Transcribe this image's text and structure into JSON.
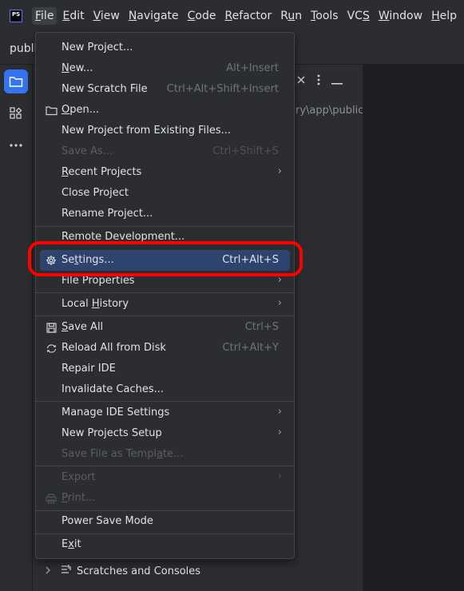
{
  "menubar": {
    "logo_text": "PS",
    "items": [
      {
        "pre": "",
        "ul": "F",
        "post": "ile"
      },
      {
        "pre": "",
        "ul": "E",
        "post": "dit"
      },
      {
        "pre": "",
        "ul": "V",
        "post": "iew"
      },
      {
        "pre": "",
        "ul": "N",
        "post": "avigate"
      },
      {
        "pre": "",
        "ul": "C",
        "post": "ode"
      },
      {
        "pre": "",
        "ul": "R",
        "post": "efactor"
      },
      {
        "pre": "R",
        "ul": "u",
        "post": "n"
      },
      {
        "pre": "",
        "ul": "T",
        "post": "ools"
      },
      {
        "pre": "VC",
        "ul": "S",
        "post": ""
      },
      {
        "pre": "",
        "ul": "W",
        "post": "indow"
      },
      {
        "pre": "",
        "ul": "H",
        "post": "elp"
      }
    ]
  },
  "project_panel": {
    "tab_label": "public",
    "path_fragment": "ry\\app\\public",
    "scratches_label": "Scratches and Consoles"
  },
  "menu": {
    "items": [
      {
        "pre": "New Project...",
        "ul": "",
        "post": "",
        "shortcut": ""
      },
      {
        "pre": "",
        "ul": "N",
        "post": "ew...",
        "shortcut": "Alt+Insert"
      },
      {
        "pre": "New Scratch File",
        "ul": "",
        "post": "",
        "shortcut": "Ctrl+Alt+Shift+Insert"
      },
      {
        "pre": "",
        "ul": "O",
        "post": "pen...",
        "shortcut": ""
      },
      {
        "pre": "New Project from Existing Files...",
        "ul": "",
        "post": "",
        "shortcut": ""
      },
      {
        "pre": "Save As...",
        "ul": "",
        "post": "",
        "shortcut": "Ctrl+Shift+S"
      },
      {
        "pre": "",
        "ul": "R",
        "post": "ecent Projects",
        "shortcut": ""
      },
      {
        "pre": "Close Project",
        "ul": "",
        "post": "",
        "shortcut": ""
      },
      {
        "pre": "Rename Project...",
        "ul": "",
        "post": "",
        "shortcut": ""
      },
      {
        "pre": "Remote Development...",
        "ul": "",
        "post": "",
        "shortcut": ""
      },
      {
        "pre": "Se",
        "ul": "t",
        "post": "tings...",
        "shortcut": "Ctrl+Alt+S"
      },
      {
        "pre": "File Properties",
        "ul": "",
        "post": "",
        "shortcut": ""
      },
      {
        "pre": "Local ",
        "ul": "H",
        "post": "istory",
        "shortcut": ""
      },
      {
        "pre": "",
        "ul": "S",
        "post": "ave All",
        "shortcut": "Ctrl+S"
      },
      {
        "pre": "Reload All from Disk",
        "ul": "",
        "post": "",
        "shortcut": "Ctrl+Alt+Y"
      },
      {
        "pre": "Repair IDE",
        "ul": "",
        "post": "",
        "shortcut": ""
      },
      {
        "pre": "Invalidate Caches...",
        "ul": "",
        "post": "",
        "shortcut": ""
      },
      {
        "pre": "Manage IDE Settings",
        "ul": "",
        "post": "",
        "shortcut": ""
      },
      {
        "pre": "New Projects Setup",
        "ul": "",
        "post": "",
        "shortcut": ""
      },
      {
        "pre": "Save File as Templ",
        "ul": "a",
        "post": "te...",
        "shortcut": ""
      },
      {
        "pre": "Export",
        "ul": "",
        "post": "",
        "shortcut": ""
      },
      {
        "pre": "",
        "ul": "P",
        "post": "rint...",
        "shortcut": ""
      },
      {
        "pre": "Power Save Mode",
        "ul": "",
        "post": "",
        "shortcut": ""
      },
      {
        "pre": "E",
        "ul": "x",
        "post": "it",
        "shortcut": ""
      }
    ]
  },
  "colors": {
    "background": "#1e1f22",
    "panel": "#2b2d30",
    "selection": "#2e436e",
    "accent": "#3574f0",
    "annotation_ring": "#ff0000"
  }
}
